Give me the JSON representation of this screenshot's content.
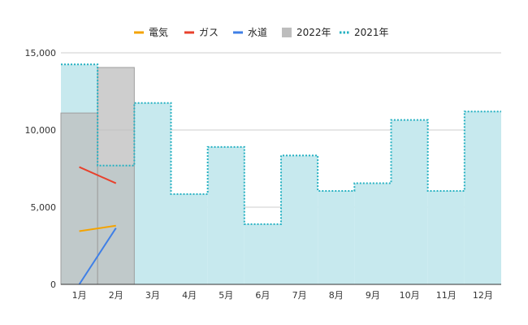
{
  "chart_data": {
    "type": "area",
    "categories": [
      "1月",
      "2月",
      "3月",
      "4月",
      "5月",
      "6月",
      "7月",
      "8月",
      "9月",
      "10月",
      "11月",
      "12月"
    ],
    "ylim": [
      0,
      15000
    ],
    "yticks": [
      0,
      5000,
      10000,
      15000
    ],
    "ytick_labels": [
      "0",
      "5,000",
      "10,000",
      "15,000"
    ],
    "grid": true,
    "legend_position": "top",
    "series": [
      {
        "name": "電気",
        "type": "line",
        "color": "#f4a300",
        "values": [
          3450,
          3800
        ]
      },
      {
        "name": "ガス",
        "type": "line",
        "color": "#e8412c",
        "values": [
          7600,
          6550
        ]
      },
      {
        "name": "水道",
        "type": "line",
        "color": "#3f7fe6",
        "values": [
          0,
          3650
        ]
      },
      {
        "name": "2022年",
        "type": "stepped-area",
        "color": "#bdbdbd",
        "values": [
          11100,
          14050
        ]
      },
      {
        "name": "2021年",
        "type": "stepped-area",
        "color": "#26b1c2",
        "fill": "#c7e9ee",
        "values": [
          14250,
          7700,
          11750,
          5850,
          8900,
          3900,
          8350,
          6050,
          6550,
          10650,
          6050,
          11200
        ]
      }
    ]
  }
}
